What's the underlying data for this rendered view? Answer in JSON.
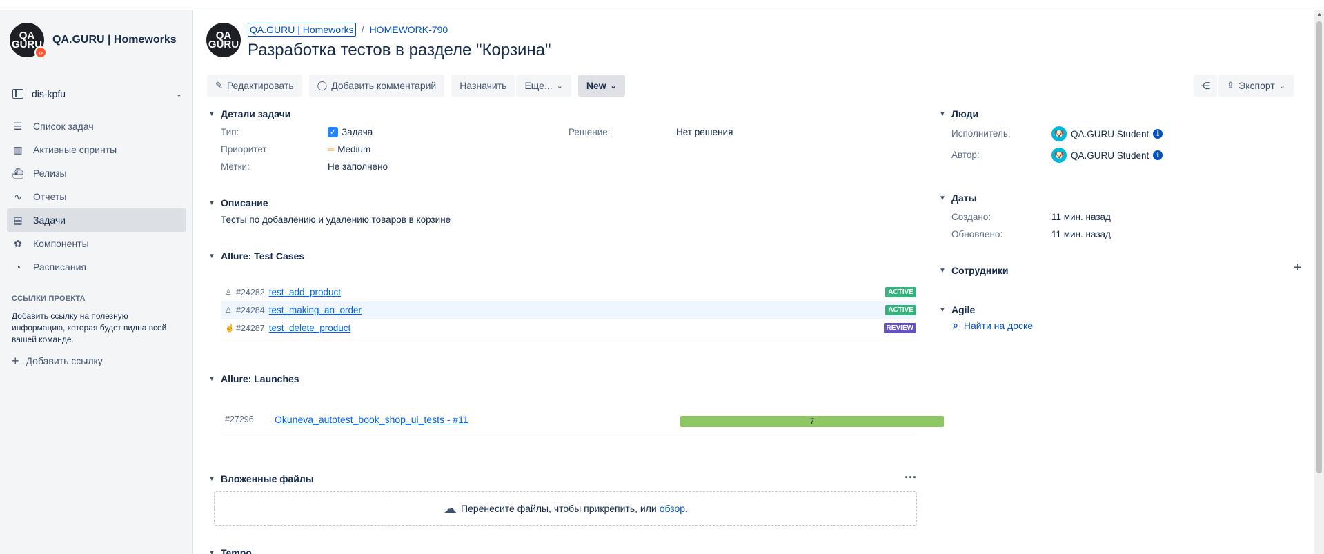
{
  "sidebar": {
    "project_name": "QA.GURU | Homeworks",
    "logo_text_top": "QA",
    "logo_text_bottom": "GURU",
    "board_selector": "dis-kpfu",
    "nav": [
      {
        "label": "Список задач",
        "icon": "backlog-icon"
      },
      {
        "label": "Активные спринты",
        "icon": "board-icon"
      },
      {
        "label": "Релизы",
        "icon": "ship-icon"
      },
      {
        "label": "Отчеты",
        "icon": "chart-icon"
      },
      {
        "label": "Задачи",
        "icon": "issues-icon",
        "active": true
      },
      {
        "label": "Компоненты",
        "icon": "component-icon"
      },
      {
        "label": "Расписания",
        "icon": "schedule-icon"
      }
    ],
    "links_title": "ССЫЛКИ ПРОЕКТА",
    "links_desc": "Добавить ссылку на полезную информацию, которая будет видна всей вашей команде.",
    "add_link_label": "Добавить ссылку"
  },
  "issue": {
    "breadcrumb_project": "QA.GURU | Homeworks",
    "breadcrumb_sep": "/",
    "breadcrumb_key": "HOMEWORK-790",
    "title": "Разработка тестов в разделе \"Корзина\""
  },
  "toolbar": {
    "edit": "Редактировать",
    "comment": "Добавить комментарий",
    "assign": "Назначить",
    "more": "Еще...",
    "status": "New",
    "export": "Экспорт"
  },
  "details": {
    "section_title": "Детали задачи",
    "type_label": "Тип:",
    "type_value": "Задача",
    "priority_label": "Приоритет:",
    "priority_value": "Medium",
    "labels_label": "Метки:",
    "labels_value": "Не заполнено",
    "resolution_label": "Решение:",
    "resolution_value": "Нет решения"
  },
  "description": {
    "section_title": "Описание",
    "text": "Тесты по добавлению и удалению товаров в корзине"
  },
  "test_cases": {
    "section_title": "Allure: Test Cases",
    "rows": [
      {
        "icon": "person-icon",
        "id": "#24282",
        "name": "test_add_product",
        "status": "ACTIVE"
      },
      {
        "icon": "person-icon",
        "id": "#24284",
        "name": "test_making_an_order",
        "status": "ACTIVE"
      },
      {
        "icon": "hand-icon",
        "id": "#24287",
        "name": "test_delete_product",
        "status": "REVIEW"
      }
    ]
  },
  "launches": {
    "section_title": "Allure: Launches",
    "rows": [
      {
        "id": "#27296",
        "name": "Okuneva_autotest_book_shop_ui_tests - #11",
        "passed": "7",
        "passed_fraction": 1.0
      }
    ]
  },
  "attachments": {
    "section_title": "Вложенные файлы",
    "drop_text": "Перенесите файлы, чтобы прикрепить, или",
    "browse_link": "обзор",
    "drop_end": "."
  },
  "tempo": {
    "section_title": "Tempo"
  },
  "people": {
    "section_title": "Люди",
    "assignee_label": "Исполнитель:",
    "assignee": "QA.GURU Student",
    "reporter_label": "Автор:",
    "reporter": "QA.GURU Student"
  },
  "dates": {
    "section_title": "Даты",
    "created_label": "Создано:",
    "created": "11 мин. назад",
    "updated_label": "Обновлено:",
    "updated": "11 мин. назад"
  },
  "employees": {
    "section_title": "Сотрудники"
  },
  "agile": {
    "section_title": "Agile",
    "link": "Найти на доске"
  },
  "colors": {
    "link": "#0052cc",
    "active_badge": "#36b37e",
    "review_badge": "#6554c0",
    "launch_bar": "#8fc764",
    "sidebar_bg": "#f4f5f7"
  }
}
